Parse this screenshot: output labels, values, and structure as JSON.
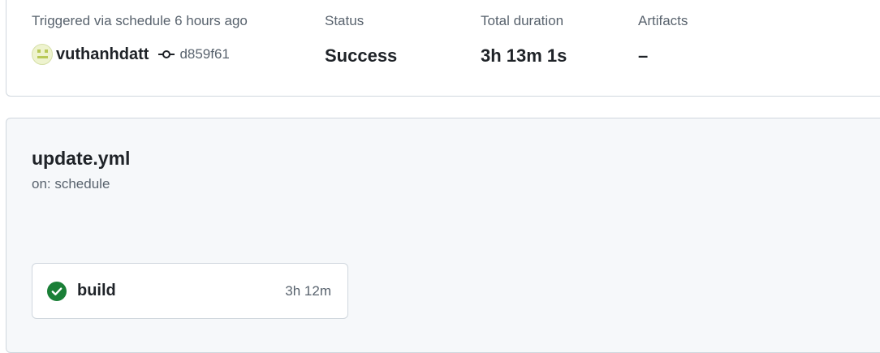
{
  "summary": {
    "trigger_text": "Triggered via schedule 6 hours ago",
    "actor": "vuthanhdatt",
    "commit_sha": "d859f61",
    "status_label": "Status",
    "status_value": "Success",
    "duration_label": "Total duration",
    "duration_value": "3h 13m 1s",
    "artifacts_label": "Artifacts",
    "artifacts_value": "–"
  },
  "workflow": {
    "file_name": "update.yml",
    "trigger": "on: schedule",
    "jobs": [
      {
        "name": "build",
        "duration": "3h 12m",
        "status": "success",
        "icon": "check-circle-icon"
      }
    ]
  },
  "colors": {
    "success": "#1a7f37",
    "muted_text": "#59636e",
    "border": "#d0d7de",
    "panel_bg": "#f6f8fa"
  }
}
